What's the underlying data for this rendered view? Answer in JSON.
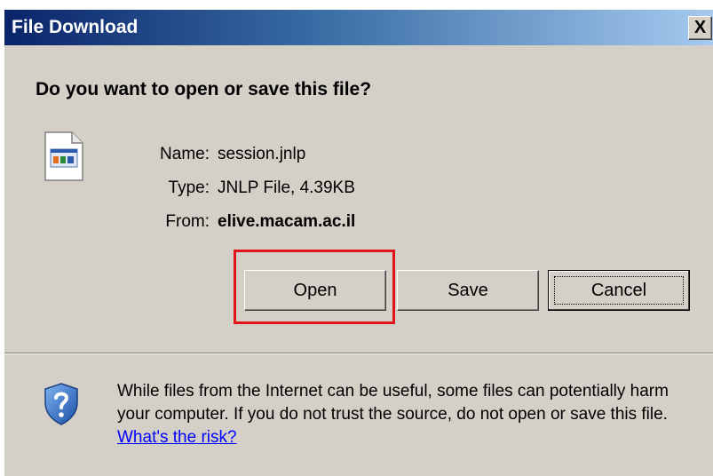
{
  "window": {
    "title": "File Download",
    "close_label": "X"
  },
  "dialog": {
    "question": "Do you want to open or save this file?",
    "file_icon": "jnlp-file-icon",
    "fields": {
      "name_label": "Name:",
      "name_value": "session.jnlp",
      "type_label": "Type:",
      "type_value": "JNLP File, 4.39KB",
      "from_label": "From:",
      "from_value": "elive.macam.ac.il"
    },
    "buttons": {
      "open_label": "Open",
      "save_label": "Save",
      "cancel_label": "Cancel"
    },
    "highlight_color": "#e0141a"
  },
  "warning": {
    "icon": "shield-question-icon",
    "text": "While files from the Internet can be useful, some files can potentially harm your computer. If you do not trust the source, do not open or save this file.",
    "link_text": "What's the risk?"
  },
  "colors": {
    "title_start": "#0a246a",
    "title_end": "#a6caf0",
    "dialog_bg": "#d4d0c8",
    "link": "#0000ff"
  }
}
